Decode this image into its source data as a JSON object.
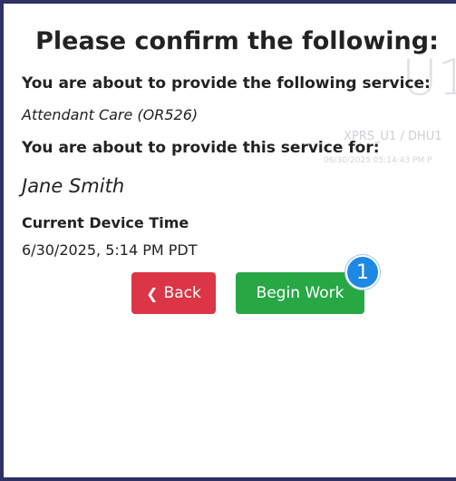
{
  "title": "Please confirm the following:",
  "service_prompt": "You are about to provide the following service:",
  "service_name": "Attendant Care (OR526)",
  "recipient_prompt": "You are about to provide this service for:",
  "recipient_name": "Jane Smith",
  "device_time_label": "Current Device Time",
  "device_time_value": "6/30/2025, 5:14 PM PDT",
  "watermark": {
    "big": "U1",
    "id": "XPRS_U1 / DHU1",
    "timestamp": "06/30/2025 05:14:43 PM P"
  },
  "buttons": {
    "back_label": "Back",
    "begin_label": "Begin Work"
  },
  "step_badge": "1",
  "icons": {
    "back": "chevron-left-icon"
  },
  "colors": {
    "back_button": "#dc3545",
    "begin_button": "#28a745",
    "badge": "#1e88e5",
    "frame": "#2d3163"
  }
}
